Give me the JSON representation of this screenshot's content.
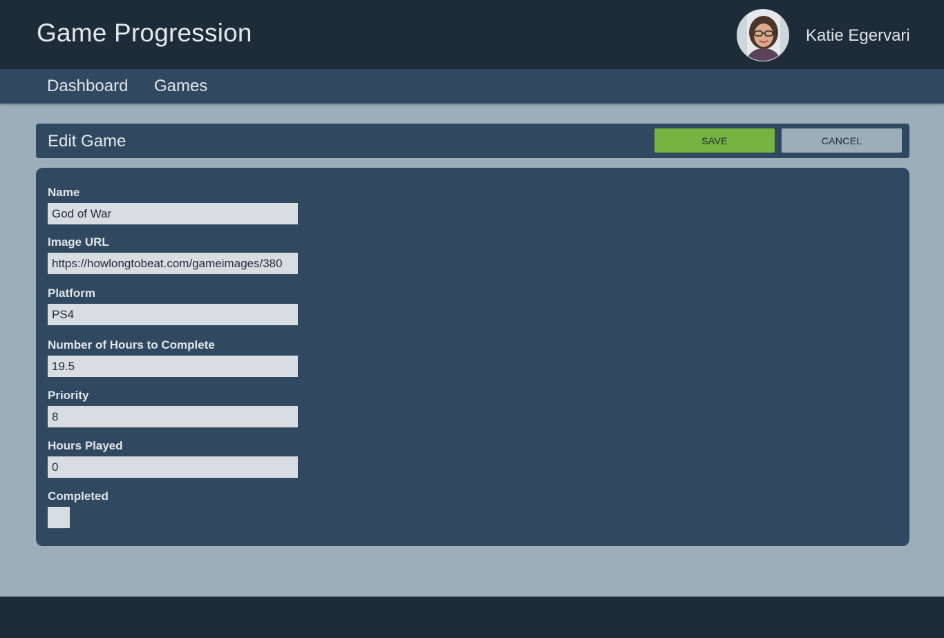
{
  "app": {
    "title": "Game Progression"
  },
  "user": {
    "name": "Katie Egervari"
  },
  "nav": {
    "items": [
      {
        "label": "Dashboard"
      },
      {
        "label": "Games"
      }
    ]
  },
  "page": {
    "title": "Edit Game",
    "save_label": "SAVE",
    "cancel_label": "CANCEL"
  },
  "form": {
    "fields": [
      {
        "label": "Name",
        "value": "God of War"
      },
      {
        "label": "Image URL",
        "value": "https://howlongtobeat.com/gameimages/380"
      },
      {
        "label": "Platform",
        "value": "PS4"
      },
      {
        "label": "Number of Hours to Complete",
        "value": "19.5"
      },
      {
        "label": "Priority",
        "value": "8"
      },
      {
        "label": "Hours Played",
        "value": "0"
      }
    ],
    "completed": {
      "label": "Completed",
      "checked": false
    }
  },
  "colors": {
    "topbar": "#1e2b39",
    "navbar": "#314960",
    "background": "#9daebb",
    "save_button": "#77b340",
    "cancel_button": "#9daebb"
  }
}
